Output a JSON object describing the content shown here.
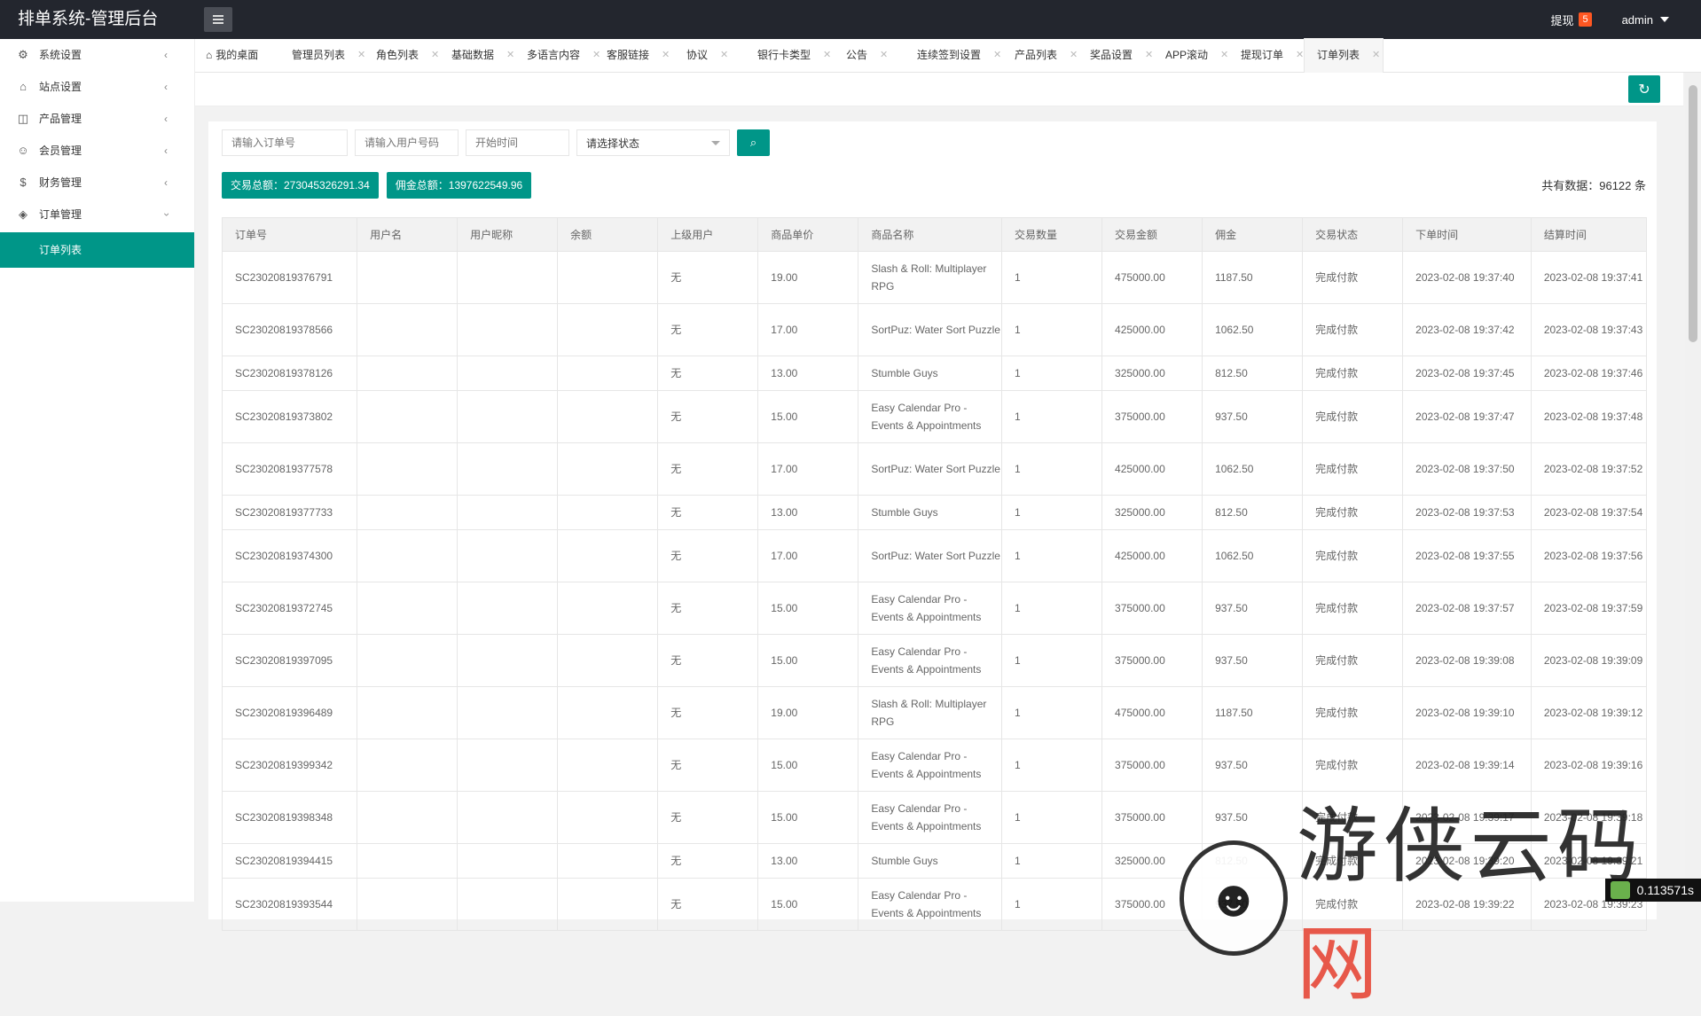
{
  "brand": "排单系统-管理后台",
  "topbar": {
    "withdraw_label": "提现",
    "withdraw_badge": "5",
    "user": "admin"
  },
  "sidebar": {
    "items": [
      {
        "label": "系统设置",
        "icon": "gear-icon",
        "glyph": "⚙"
      },
      {
        "label": "站点设置",
        "icon": "site-icon",
        "glyph": "⌂"
      },
      {
        "label": "产品管理",
        "icon": "box-icon",
        "glyph": "◫"
      },
      {
        "label": "会员管理",
        "icon": "user-icon",
        "glyph": "☺"
      },
      {
        "label": "财务管理",
        "icon": "dollar-icon",
        "glyph": "$"
      },
      {
        "label": "订单管理",
        "icon": "cube-icon",
        "glyph": "◈"
      }
    ],
    "sub_active": "订单列表"
  },
  "tabs": [
    {
      "label": "我的桌面",
      "home": true
    },
    {
      "label": "管理员列表"
    },
    {
      "label": "角色列表"
    },
    {
      "label": "基础数据"
    },
    {
      "label": "多语言内容"
    },
    {
      "label": "客服链接"
    },
    {
      "label": "协议"
    },
    {
      "label": "银行卡类型"
    },
    {
      "label": "公告"
    },
    {
      "label": "连续签到设置"
    },
    {
      "label": "产品列表"
    },
    {
      "label": "奖品设置"
    },
    {
      "label": "APP滚动"
    },
    {
      "label": "提现订单"
    },
    {
      "label": "订单列表",
      "active": true
    }
  ],
  "search": {
    "order_placeholder": "请输入订单号",
    "user_placeholder": "请输入用户号码",
    "time_placeholder": "开始时间",
    "status_select": "请选择状态"
  },
  "summary": {
    "trade_total": "交易总额：273045326291.34",
    "commission_total": "佣金总额：1397622549.96",
    "count_text": "共有数据：96122 条"
  },
  "table": {
    "headers": [
      "订单号",
      "用户名",
      "用户昵称",
      "余额",
      "上级用户",
      "商品单价",
      "商品名称",
      "交易数量",
      "交易金额",
      "佣金",
      "交易状态",
      "下单时间",
      "结算时间"
    ],
    "rows": [
      [
        "SC23020819376791",
        "",
        "",
        "",
        "无",
        "19.00",
        "Slash & Roll: Multiplayer RPG",
        "1",
        "475000.00",
        "1187.50",
        "完成付款",
        "2023-02-08 19:37:40",
        "2023-02-08 19:37:41"
      ],
      [
        "SC23020819378566",
        "",
        "",
        "",
        "无",
        "17.00",
        "SortPuz: Water Sort Puzzle",
        "1",
        "425000.00",
        "1062.50",
        "完成付款",
        "2023-02-08 19:37:42",
        "2023-02-08 19:37:43"
      ],
      [
        "SC23020819378126",
        "",
        "",
        "",
        "无",
        "13.00",
        "Stumble Guys",
        "1",
        "325000.00",
        "812.50",
        "完成付款",
        "2023-02-08 19:37:45",
        "2023-02-08 19:37:46"
      ],
      [
        "SC23020819373802",
        "",
        "",
        "",
        "无",
        "15.00",
        "Easy Calendar Pro - Events & Appointments",
        "1",
        "375000.00",
        "937.50",
        "完成付款",
        "2023-02-08 19:37:47",
        "2023-02-08 19:37:48"
      ],
      [
        "SC23020819377578",
        "",
        "",
        "",
        "无",
        "17.00",
        "SortPuz: Water Sort Puzzle",
        "1",
        "425000.00",
        "1062.50",
        "完成付款",
        "2023-02-08 19:37:50",
        "2023-02-08 19:37:52"
      ],
      [
        "SC23020819377733",
        "",
        "",
        "",
        "无",
        "13.00",
        "Stumble Guys",
        "1",
        "325000.00",
        "812.50",
        "完成付款",
        "2023-02-08 19:37:53",
        "2023-02-08 19:37:54"
      ],
      [
        "SC23020819374300",
        "",
        "",
        "",
        "无",
        "17.00",
        "SortPuz: Water Sort Puzzle",
        "1",
        "425000.00",
        "1062.50",
        "完成付款",
        "2023-02-08 19:37:55",
        "2023-02-08 19:37:56"
      ],
      [
        "SC23020819372745",
        "",
        "",
        "",
        "无",
        "15.00",
        "Easy Calendar Pro - Events & Appointments",
        "1",
        "375000.00",
        "937.50",
        "完成付款",
        "2023-02-08 19:37:57",
        "2023-02-08 19:37:59"
      ],
      [
        "SC23020819397095",
        "",
        "",
        "",
        "无",
        "15.00",
        "Easy Calendar Pro - Events & Appointments",
        "1",
        "375000.00",
        "937.50",
        "完成付款",
        "2023-02-08 19:39:08",
        "2023-02-08 19:39:09"
      ],
      [
        "SC23020819396489",
        "",
        "",
        "",
        "无",
        "19.00",
        "Slash & Roll: Multiplayer RPG",
        "1",
        "475000.00",
        "1187.50",
        "完成付款",
        "2023-02-08 19:39:10",
        "2023-02-08 19:39:12"
      ],
      [
        "SC23020819399342",
        "",
        "",
        "",
        "无",
        "15.00",
        "Easy Calendar Pro - Events & Appointments",
        "1",
        "375000.00",
        "937.50",
        "完成付款",
        "2023-02-08 19:39:14",
        "2023-02-08 19:39:16"
      ],
      [
        "SC23020819398348",
        "",
        "",
        "",
        "无",
        "15.00",
        "Easy Calendar Pro - Events & Appointments",
        "1",
        "375000.00",
        "937.50",
        "完成付款",
        "2023-02-08 19:39:17",
        "2023-02-08 19:39:18"
      ],
      [
        "SC23020819394415",
        "",
        "",
        "",
        "无",
        "13.00",
        "Stumble Guys",
        "1",
        "325000.00",
        "812.50",
        "完成付款",
        "2023-02-08 19:39:20",
        "2023-02-08 19:39:21"
      ],
      [
        "SC23020819393544",
        "",
        "",
        "",
        "无",
        "15.00",
        "Easy Calendar Pro - Events & Appointments",
        "1",
        "375000.00",
        "937.50",
        "完成付款",
        "2023-02-08 19:39:22",
        "2023-02-08 19:39:23"
      ]
    ]
  },
  "watermark": {
    "text_main": "游侠云码",
    "text_red": "网"
  },
  "timer": "0.113571s",
  "colors": {
    "accent": "#009688",
    "topbar": "#23262e",
    "badge": "#ff5722"
  }
}
